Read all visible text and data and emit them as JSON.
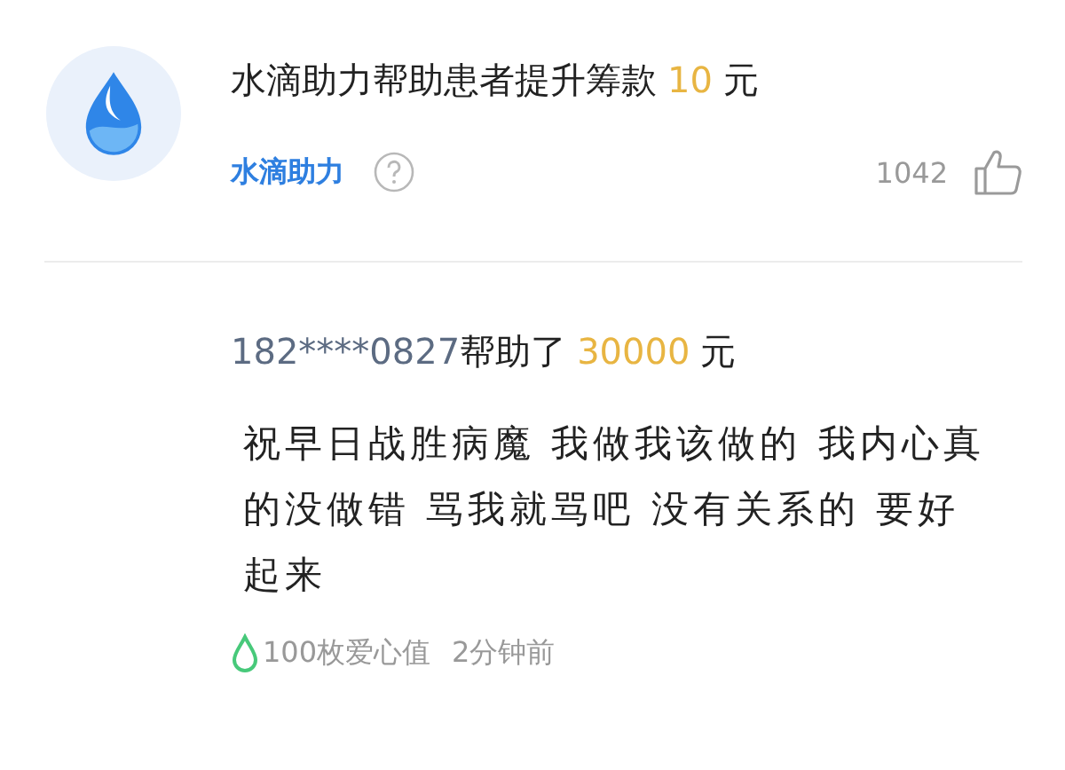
{
  "platform_post": {
    "title_parts": [
      {
        "kind": "plain",
        "text": "水滴助力帮助患者提升筹款"
      },
      {
        "kind": "amount",
        "text": "10"
      },
      {
        "kind": "plain",
        "text": "元"
      }
    ],
    "author": "水滴助力",
    "likes": "1042"
  },
  "donation": {
    "title_parts": [
      {
        "kind": "user",
        "text": "182****0827"
      },
      {
        "kind": "plain",
        "text": "帮助了"
      },
      {
        "kind": "amount",
        "text": "30000"
      },
      {
        "kind": "plain",
        "text": "元"
      }
    ],
    "message": "祝早日战胜病魔 我做我该做的 我内心真的没做错 骂我就骂吧 没有关系的 要好起来",
    "love_points": "100枚爱心值",
    "time": "2分钟前"
  }
}
